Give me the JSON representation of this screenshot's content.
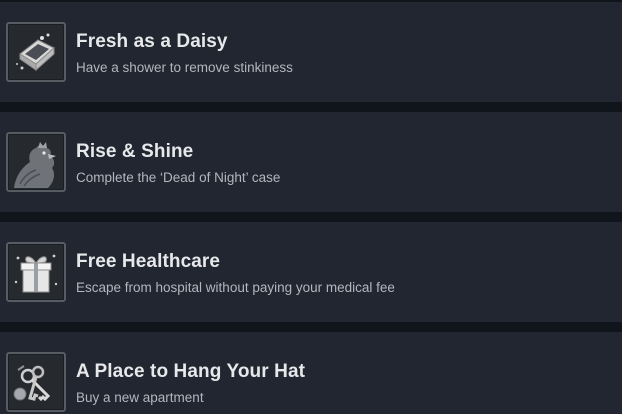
{
  "achievements": [
    {
      "title": "Fresh as a Daisy",
      "description": "Have a shower to remove stinkiness",
      "icon": "bathtub-icon"
    },
    {
      "title": "Rise & Shine",
      "description": "Complete the ‘Dead of Night’ case",
      "icon": "rooster-icon"
    },
    {
      "title": "Free Healthcare",
      "description": "Escape from hospital without paying your medical fee",
      "icon": "gift-icon"
    },
    {
      "title": "A Place to Hang Your Hat",
      "description": "Buy a new apartment",
      "icon": "keys-icon"
    }
  ]
}
